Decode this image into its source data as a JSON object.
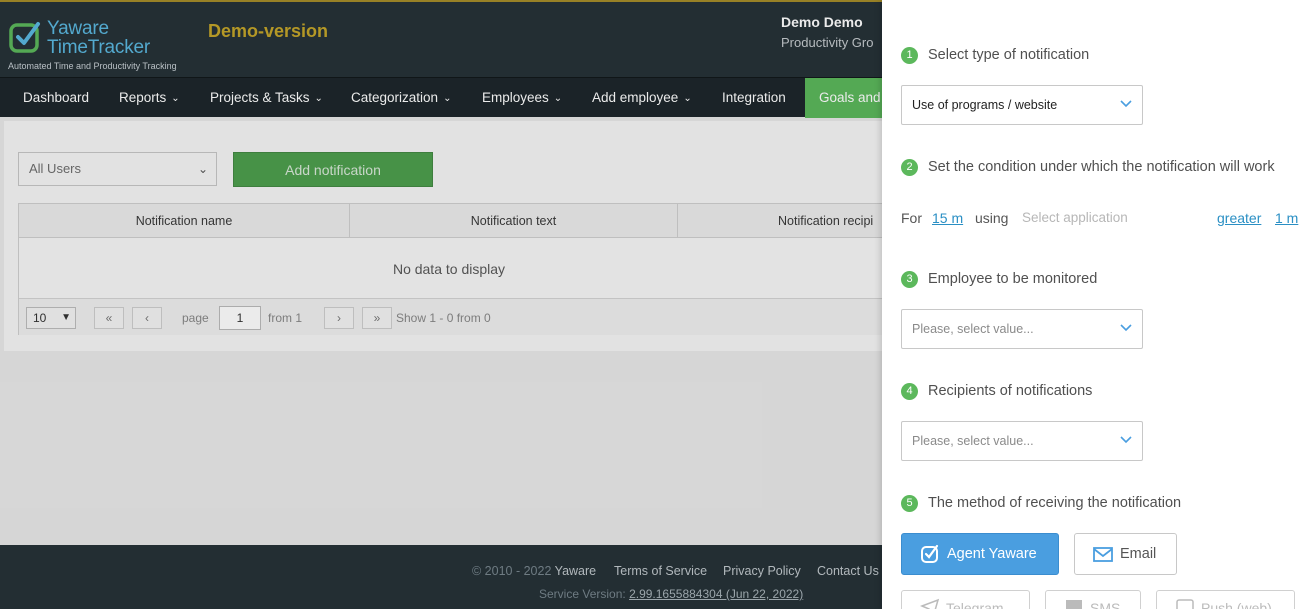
{
  "header": {
    "logo_line1": "Yaware",
    "logo_line2": "TimeTracker",
    "logo_tagline": "Automated Time and Productivity Tracking",
    "demo_label": "Demo-version",
    "user_name": "Demo Demo",
    "user_group": "Productivity Gro"
  },
  "nav": {
    "items": [
      {
        "label": "Dashboard"
      },
      {
        "label": "Reports"
      },
      {
        "label": "Projects & Tasks"
      },
      {
        "label": "Categorization"
      },
      {
        "label": "Employees"
      },
      {
        "label": "Add employee"
      },
      {
        "label": "Integration"
      },
      {
        "label": "Goals and"
      }
    ]
  },
  "toolbar": {
    "user_filter_value": "All Users",
    "add_button_label": "Add notification"
  },
  "table": {
    "columns": [
      "Notification name",
      "Notification text",
      "Notification recipi"
    ],
    "empty_text": "No data to display"
  },
  "pager": {
    "page_size": "10",
    "page_label": "page",
    "page_value": "1",
    "from_label": "from 1",
    "show_text": "Show 1 - 0 from 0",
    "first_icon": "double-chevron-left",
    "prev_icon": "chevron-left",
    "next_icon": "chevron-right",
    "last_icon": "double-chevron-right"
  },
  "footer": {
    "copyright": "© 2010 - 2022",
    "brand": "Yaware",
    "terms": "Terms of Service",
    "privacy": "Privacy Policy",
    "contact": "Contact Us",
    "version_label": "Service Version:",
    "version_value": "2.99.1655884304 (Jun 22, 2022)"
  },
  "drawer": {
    "steps": [
      {
        "num": "1",
        "label": "Select type of notification"
      },
      {
        "num": "2",
        "label": "Set the condition under which the notification will work"
      },
      {
        "num": "3",
        "label": "Employee to be monitored"
      },
      {
        "num": "4",
        "label": "Recipients of notifications"
      },
      {
        "num": "5",
        "label": "The method of receiving the notification"
      }
    ],
    "type_value": "Use of programs / website",
    "condition": {
      "for_label": "For",
      "duration": "15 m",
      "using_label": "using",
      "app_placeholder": "Select application",
      "comparator": "greater",
      "threshold": "1 m"
    },
    "employee_placeholder": "Please, select value...",
    "recipients_placeholder": "Please, select value...",
    "methods": {
      "agent": "Agent Yaware",
      "email": "Email",
      "telegram": "Telegram",
      "sms": "SMS",
      "push": "Push (web)"
    }
  },
  "colors": {
    "header_bg": "#263238",
    "nav_bg": "#1e272c",
    "accent_green": "#5cb85c",
    "accent_blue": "#4a9ee0",
    "demo_gold": "#c4a52a",
    "link_blue": "#2a8fc4"
  }
}
